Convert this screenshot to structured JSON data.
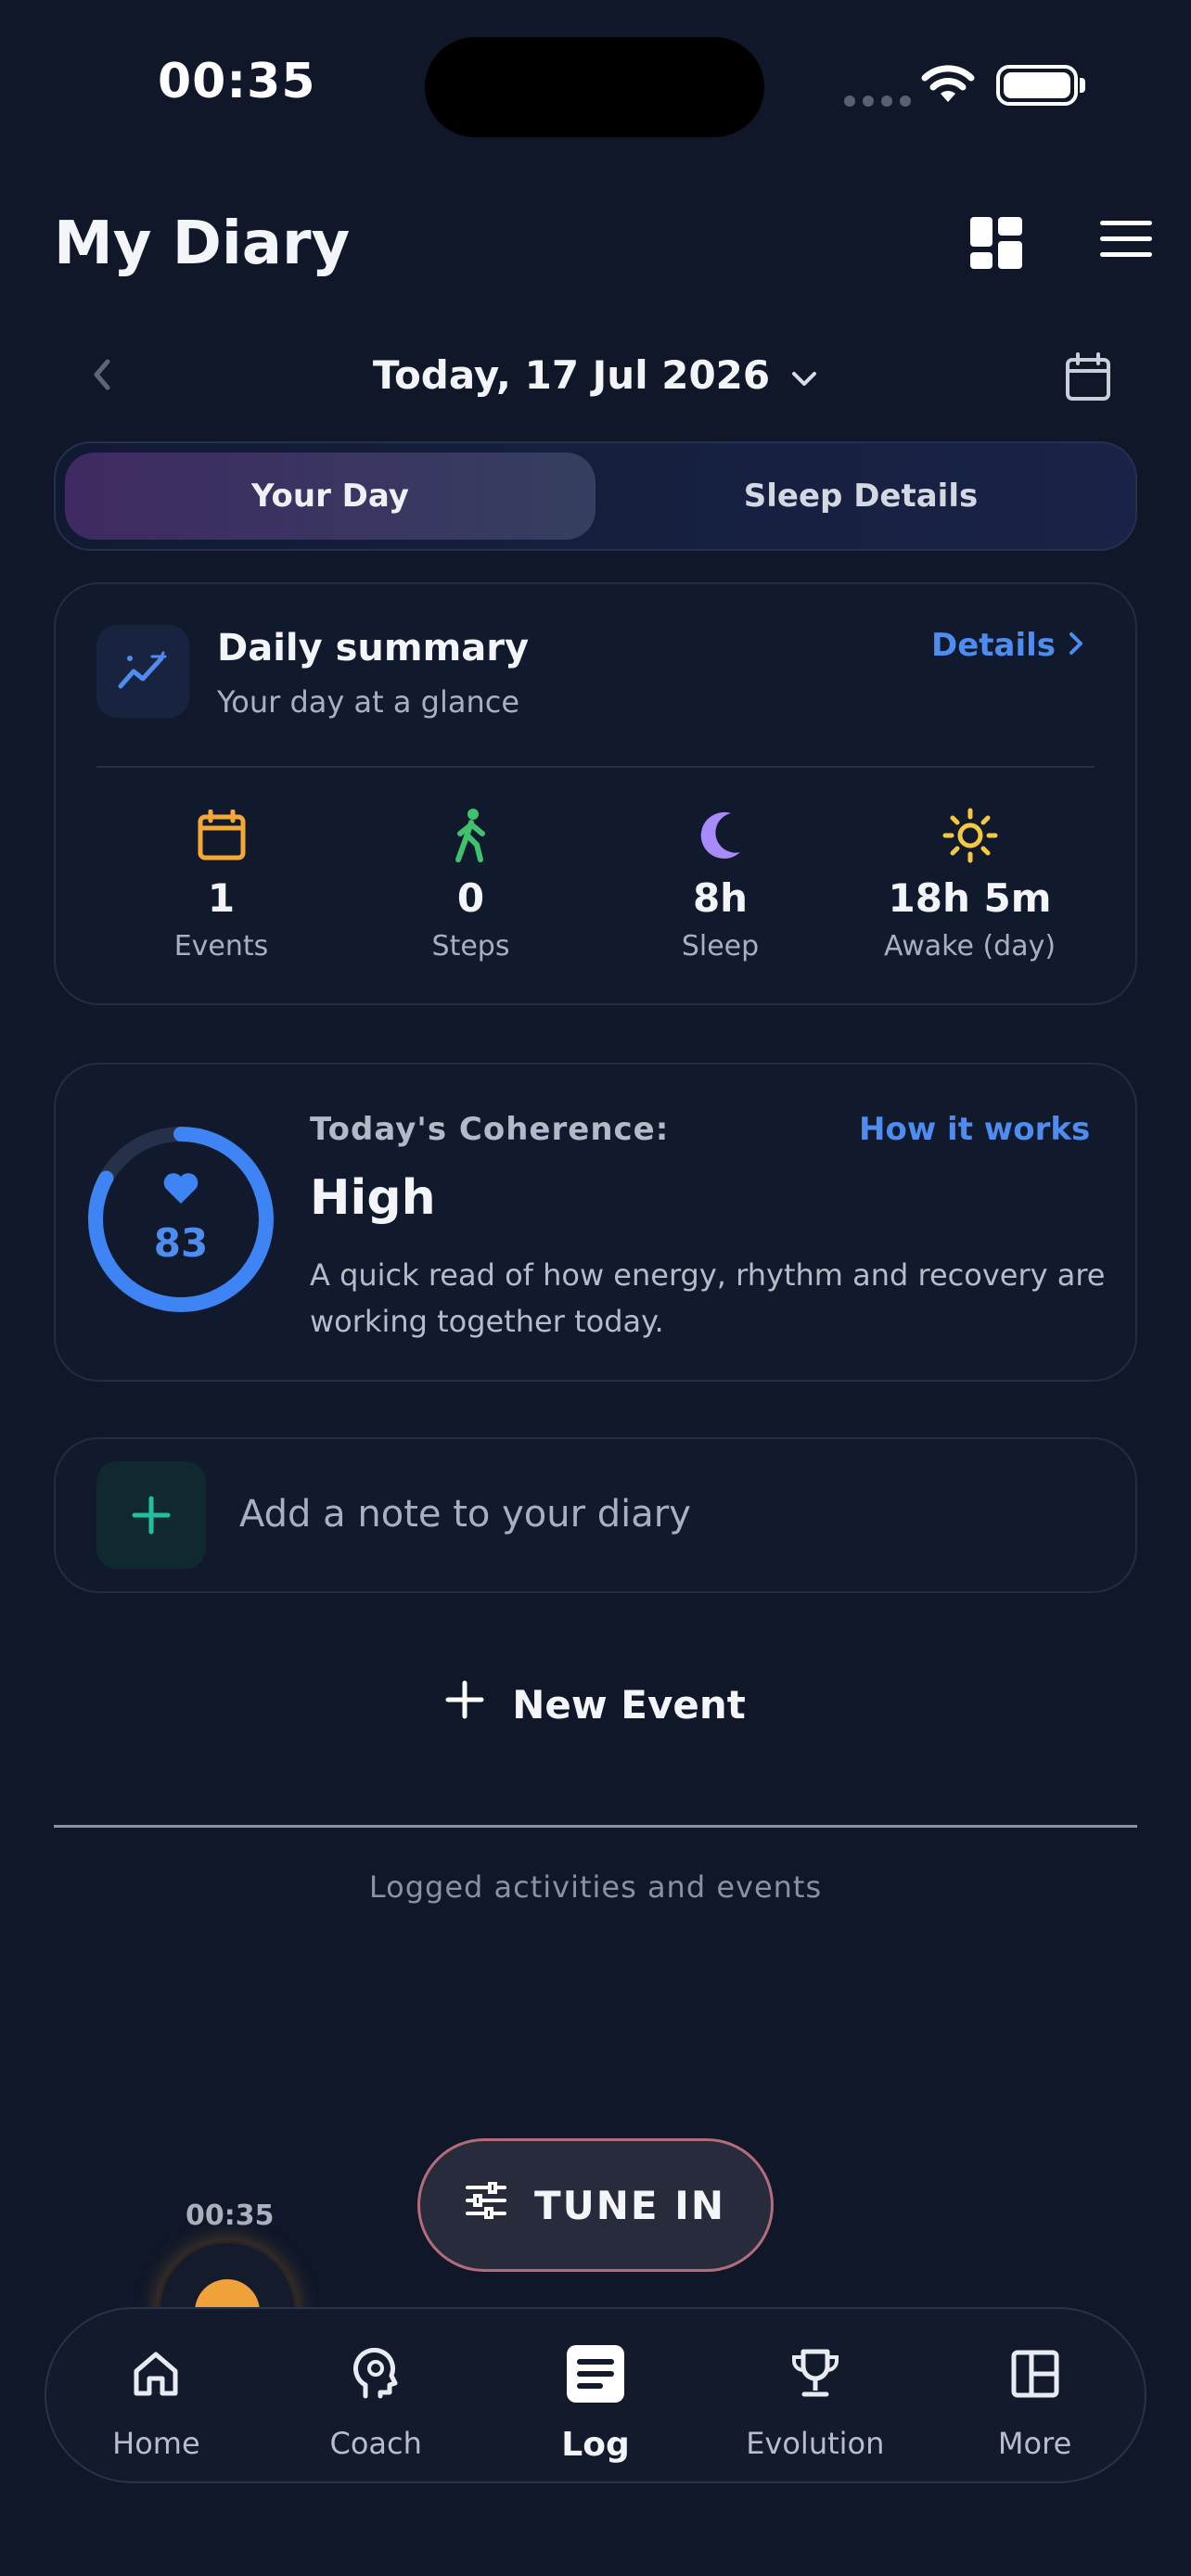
{
  "status_bar": {
    "time": "00:35"
  },
  "header": {
    "title": "My Diary",
    "icons": [
      "grid-icon",
      "menu-icon"
    ]
  },
  "date_nav": {
    "label": "Today, 17 Jul 2026"
  },
  "tabs": [
    {
      "label": "Your Day",
      "active": true
    },
    {
      "label": "Sleep Details",
      "active": false
    }
  ],
  "summary": {
    "title": "Daily summary",
    "subtitle": "Your day at a glance",
    "details_label": "Details",
    "stats": [
      {
        "value": "1",
        "label": "Events",
        "icon": "calendar-icon",
        "color": "#f5a833"
      },
      {
        "value": "0",
        "label": "Steps",
        "icon": "walk-icon",
        "color": "#3fc26b"
      },
      {
        "value": "8h",
        "label": "Sleep",
        "icon": "moon-icon",
        "color": "#a78bfa"
      },
      {
        "value": "18h 5m",
        "label": "Awake (day)",
        "icon": "sun-icon",
        "color": "#f5c842"
      }
    ]
  },
  "coherence": {
    "heading": "Today's Coherence:",
    "how_label": "How it works",
    "score": "83",
    "score_fraction": 0.83,
    "level": "High",
    "description": "A quick read of how energy, rhythm and recovery are working together today."
  },
  "note": {
    "placeholder": "Add a note to your diary"
  },
  "new_event": {
    "label": "New Event"
  },
  "section_caption": "Logged activities and events",
  "floating": {
    "time": "00:35",
    "tune_in_label": "TUNE IN"
  },
  "nav": [
    {
      "label": "Home",
      "icon": "home-icon",
      "active": false
    },
    {
      "label": "Coach",
      "icon": "coach-icon",
      "active": false
    },
    {
      "label": "Log",
      "icon": "log-icon",
      "active": true
    },
    {
      "label": "Evolution",
      "icon": "trophy-icon",
      "active": false
    },
    {
      "label": "More",
      "icon": "more-icon",
      "active": false
    }
  ],
  "colors": {
    "accent": "#4f8cf0",
    "background": "#0f1729",
    "teal": "#1fbf9f"
  }
}
